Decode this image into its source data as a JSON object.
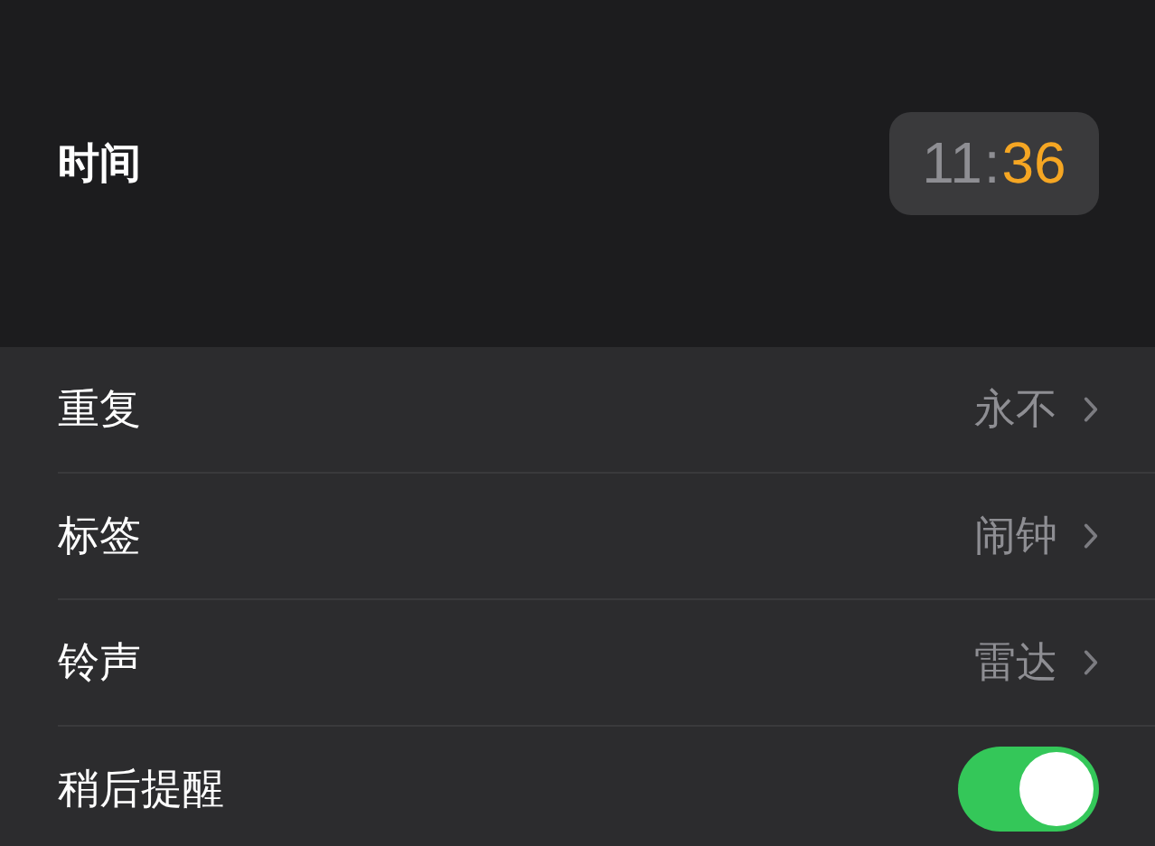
{
  "time": {
    "label": "时间",
    "hour": "11",
    "separator": ":",
    "minute": "36"
  },
  "settings": [
    {
      "kind": "disclosure",
      "label": "重复",
      "value": "永不"
    },
    {
      "kind": "disclosure",
      "label": "标签",
      "value": "闹钟"
    },
    {
      "kind": "disclosure",
      "label": "铃声",
      "value": "雷达"
    },
    {
      "kind": "toggle",
      "label": "稍后提醒",
      "on": true
    }
  ]
}
